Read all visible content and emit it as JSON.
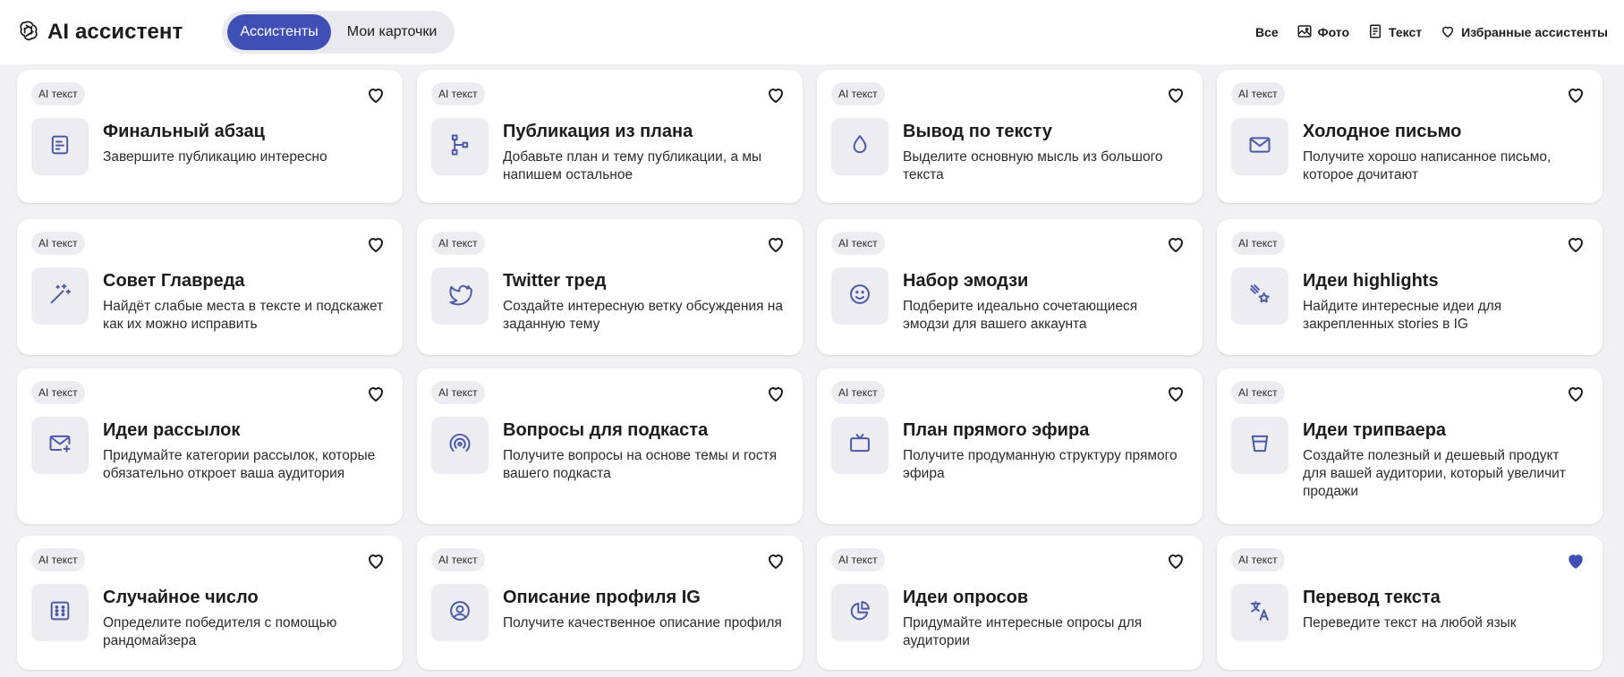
{
  "header": {
    "logo_text": "AI ассистент",
    "tabs": [
      "Ассистенты",
      "Мои карточки"
    ],
    "active_tab": 0,
    "filters": [
      {
        "label": "Все",
        "icon": "none"
      },
      {
        "label": "Фото",
        "icon": "image-icon"
      },
      {
        "label": "Текст",
        "icon": "document-icon"
      },
      {
        "label": "Избранные ассистенты",
        "icon": "heart-outline-icon"
      }
    ]
  },
  "colors": {
    "accent": "#3f4fb5",
    "icon": "#4a5aa8",
    "background": "#f1f1f3"
  },
  "cards": [
    {
      "badge": "AI текст",
      "title": "Финальный абзац",
      "desc": "Завершите публикацию интересно",
      "icon": "text-doc-icon",
      "favorite": false
    },
    {
      "badge": "AI текст",
      "title": "Публикация из плана",
      "desc": "Добавьте план и тему публикации, а мы напишем остальное",
      "icon": "tree-structure-icon",
      "favorite": false
    },
    {
      "badge": "AI текст",
      "title": "Вывод по тексту",
      "desc": "Выделите основную мысль из большого текста",
      "icon": "drop-icon",
      "favorite": false
    },
    {
      "badge": "AI текст",
      "title": "Холодное письмо",
      "desc": "Получите хорошо написанное письмо, которое дочитают",
      "icon": "envelope-icon",
      "favorite": false
    },
    {
      "badge": "AI текст",
      "title": "Совет Главреда",
      "desc": "Найдёт слабые места в тексте и подскажет как их можно исправить",
      "icon": "magic-wand-icon",
      "favorite": false
    },
    {
      "badge": "AI текст",
      "title": "Twitter тред",
      "desc": "Создайте интересную ветку обсуждения на заданную тему",
      "icon": "twitter-bird-icon",
      "favorite": false
    },
    {
      "badge": "AI текст",
      "title": "Набор эмодзи",
      "desc": "Подберите идеально сочетающиеся эмодзи для вашего аккаунта",
      "icon": "smiley-icon",
      "favorite": false
    },
    {
      "badge": "AI текст",
      "title": "Идеи highlights",
      "desc": "Найдите интересные идеи для закрепленных stories в IG",
      "icon": "shooting-star-icon",
      "favorite": false
    },
    {
      "badge": "AI текст",
      "title": "Идеи рассылок",
      "desc": "Придумайте категории рассылок, которые обязательно откроет ваша аудитория",
      "icon": "mail-sparkle-icon",
      "favorite": false
    },
    {
      "badge": "AI текст",
      "title": "Вопросы для подкаста",
      "desc": "Получите вопросы на основе темы и гостя вашего подкаста",
      "icon": "podcast-icon",
      "favorite": false
    },
    {
      "badge": "AI текст",
      "title": "План прямого эфира",
      "desc": "Получите продуманную структуру прямого эфира",
      "icon": "tv-icon",
      "favorite": false
    },
    {
      "badge": "AI текст",
      "title": "Идеи трипваера",
      "desc": "Создайте полезный и дешевый продукт для вашей аудитории, который увеличит продажи",
      "icon": "funnel-icon",
      "favorite": false
    },
    {
      "badge": "AI текст",
      "title": "Случайное число",
      "desc": "Определите победителя с помощью рандомайзера",
      "icon": "dice-icon",
      "favorite": false
    },
    {
      "badge": "AI текст",
      "title": "Описание профиля IG",
      "desc": "Получите качественное описание профиля",
      "icon": "user-circle-icon",
      "favorite": false
    },
    {
      "badge": "AI текст",
      "title": "Идеи опросов",
      "desc": "Придумайте интересные опросы для аудитории",
      "icon": "pie-chart-icon",
      "favorite": false
    },
    {
      "badge": "AI текст",
      "title": "Перевод текста",
      "desc": "Переведите текст на любой язык",
      "icon": "translate-icon",
      "favorite": true
    }
  ]
}
